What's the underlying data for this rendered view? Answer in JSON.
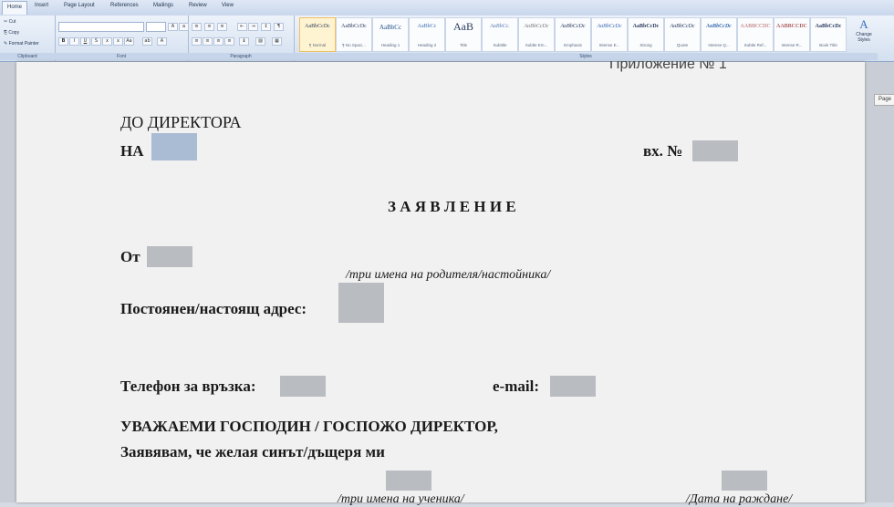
{
  "ribbon": {
    "tabs": [
      "Home",
      "Insert",
      "Page Layout",
      "References",
      "Mailings",
      "Review",
      "View"
    ],
    "clipboard": {
      "cut": "Cut",
      "copy": "Copy",
      "format_painter": "Format Painter",
      "label": "Clipboard"
    },
    "font_label": "Font",
    "paragraph_label": "Paragraph",
    "styles_label": "Styles",
    "styles": [
      {
        "sample": "AaBbCcDc",
        "name": "¶ Normal"
      },
      {
        "sample": "AaBbCcDc",
        "name": "¶ No Spaci..."
      },
      {
        "sample": "AaBbCc",
        "name": "Heading 1"
      },
      {
        "sample": "AaBbCc",
        "name": "Heading 2"
      },
      {
        "sample": "AaB",
        "name": "Title"
      },
      {
        "sample": "AaBbCc.",
        "name": "Subtitle"
      },
      {
        "sample": "AaBbCcDc",
        "name": "Subtle Em..."
      },
      {
        "sample": "AaBbCcDc",
        "name": "Emphasis"
      },
      {
        "sample": "AaBbCcDc",
        "name": "Intense E..."
      },
      {
        "sample": "AaBbCcDc",
        "name": "Strong"
      },
      {
        "sample": "AaBbCcDc",
        "name": "Quote"
      },
      {
        "sample": "AaBbCcDc",
        "name": "Intense Q..."
      },
      {
        "sample": "AABBCCDC",
        "name": "Subtle Ref..."
      },
      {
        "sample": "AABBCCDC",
        "name": "Intense R..."
      },
      {
        "sample": "AaBbCcDc",
        "name": "Book Title"
      }
    ],
    "change_styles": "Change Styles"
  },
  "document": {
    "appendix": "Приложение № 1",
    "to_director": "ДО ДИРЕКТОРА",
    "na": "НА",
    "incoming_no": "вх. №",
    "title": "З А Я В Л Е Н И Е",
    "from": "От",
    "parent_hint": "/три имена на родителя/настойника/",
    "address": "Постоянен/настоящ адрес:",
    "phone": "Телефон за връзка:",
    "email": "e-mail:",
    "greeting": "УВАЖАЕМИ ГОСПОДИН / ГОСПОЖО ДИРЕКТОР,",
    "declare": "Заявявам, че желая синът/дъщеря ми",
    "student_hint": "/три имена на ученика/",
    "birth_hint": "/Дата на раждане/"
  },
  "side_tag": "Page"
}
